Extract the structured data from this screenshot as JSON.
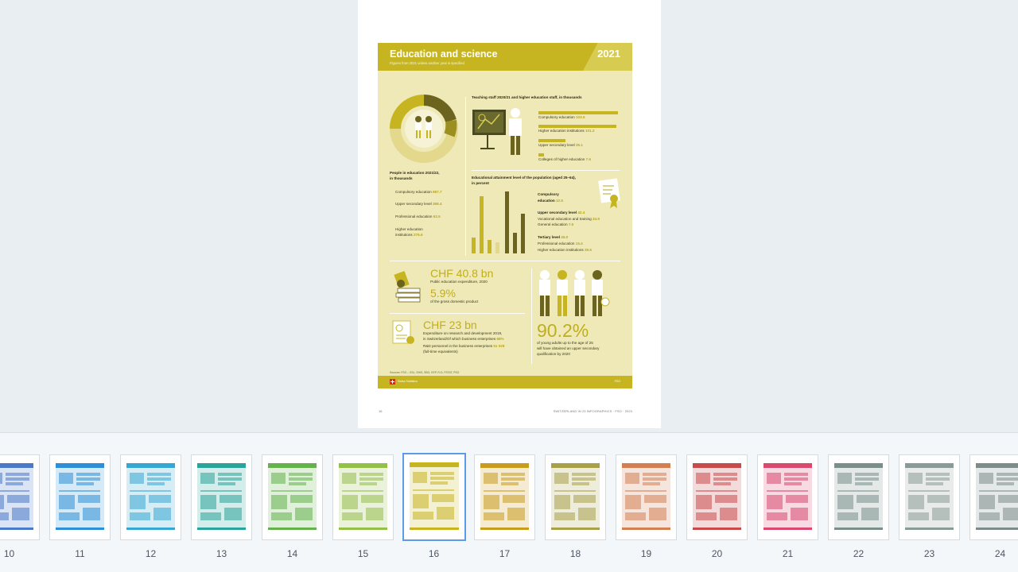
{
  "document": {
    "page_footer_left": "16",
    "page_footer_right": "SWITZERLAND IN 23 INFOGRAPHICS · FSO · 2023"
  },
  "infographic": {
    "title": "Education and science",
    "subtitle": "Figures from 2021 unless another year is specified",
    "year": "2021",
    "people": {
      "heading_line1": "People in education 2021/22,",
      "heading_line2": "in thousands",
      "items": [
        {
          "label": "Compulsory education",
          "value": "987.7"
        },
        {
          "label": "Upper secondary level",
          "value": "368.4"
        },
        {
          "label": "Professional education",
          "value": "62.5"
        },
        {
          "label_line1": "Higher education",
          "label_line2": "institutions",
          "value": "276.6"
        }
      ]
    },
    "teaching": {
      "heading": "Teaching staff 2020/21 and higher education staff, in thousands",
      "items": [
        {
          "label": "Compulsory education",
          "value": "103.5",
          "fraction": 1.0
        },
        {
          "label": "Higher education institutions",
          "value": "101.2",
          "fraction": 0.98
        },
        {
          "label": "Upper secondary level",
          "value": "35.1",
          "fraction": 0.34
        },
        {
          "label": "Colleges of higher education",
          "value": "7.6",
          "fraction": 0.07
        }
      ]
    },
    "attainment": {
      "heading_line1": "Educational attainment level of the population (aged 25–64),",
      "heading_line2": "in percent",
      "compulsory_label_line1": "Compulsory",
      "compulsory_label_line2": "education",
      "compulsory_value": "12.5",
      "upper_label": "Upper secondary level",
      "upper_value": "42.4",
      "upper_items": [
        {
          "label": "Vocational education and training",
          "value": "34.9"
        },
        {
          "label": "General education",
          "value": "7.5"
        }
      ],
      "tertiary_label": "Tertiary level",
      "tertiary_value": "45.0",
      "tertiary_items": [
        {
          "label": "Professional education",
          "value": "15.4"
        },
        {
          "label": "Higher education institutions",
          "value": "29.6"
        }
      ]
    },
    "expenditure": {
      "amount": "CHF 40.8 bn",
      "label": "Public education expenditure, 2020",
      "pct": "5.9%",
      "pct_label": "of the gross domestic product"
    },
    "rnd": {
      "amount": "CHF 23 bn",
      "line1": "Expenditure on research and development 2019,",
      "line2_prefix": "in Switzerland/Of which business enterprises",
      "line2_value": "68%",
      "line3_prefix": "R&D personnel in the business enterprises",
      "line3_value": "51 028",
      "line4": "(full-time equivalents)"
    },
    "youth": {
      "pct": "90.2%",
      "line1": "of young adults up to the age of 25",
      "line2": "will have obtained an upper secondary",
      "line3": "qualification by 2020"
    },
    "sources": "Sources: FSO – SSL, SHIS, SBG, EEP, R-D, FSTAT, PSO",
    "org": "Swiss Statistics",
    "code": "FSO"
  },
  "thumbnails": [
    {
      "num": "10",
      "color": "#4a79c8"
    },
    {
      "num": "11",
      "color": "#2d8fd6"
    },
    {
      "num": "12",
      "color": "#36a6d2"
    },
    {
      "num": "13",
      "color": "#2aa39a"
    },
    {
      "num": "14",
      "color": "#63b24a"
    },
    {
      "num": "15",
      "color": "#94c04a"
    },
    {
      "num": "16",
      "color": "#c6b520"
    },
    {
      "num": "17",
      "color": "#c89d1e"
    },
    {
      "num": "18",
      "color": "#a9a14a"
    },
    {
      "num": "19",
      "color": "#d27f52"
    },
    {
      "num": "20",
      "color": "#c84a4a"
    },
    {
      "num": "21",
      "color": "#d9486f"
    },
    {
      "num": "22",
      "color": "#7a8f8a"
    },
    {
      "num": "23",
      "color": "#8a9a96"
    },
    {
      "num": "24",
      "color": "#7d8c8a"
    }
  ],
  "selected_thumbnail": "16"
}
